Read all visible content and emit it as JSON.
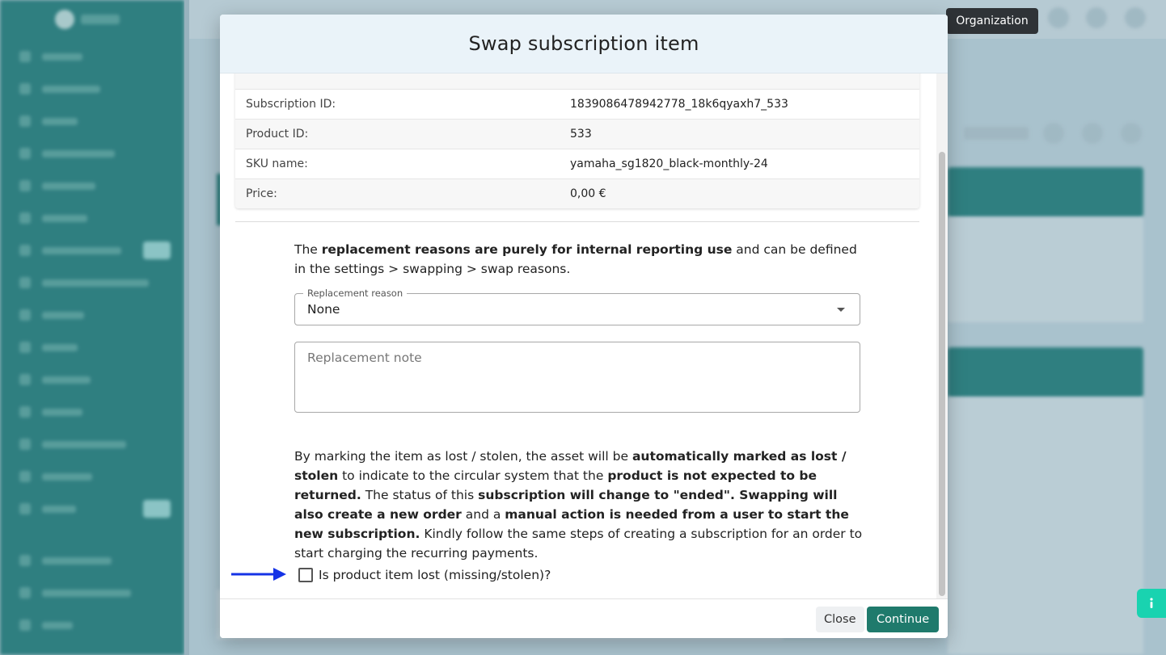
{
  "tooltip": {
    "label": "Organization"
  },
  "modal": {
    "title": "Swap subscription item",
    "details": [
      {
        "label": "Subscription ID:",
        "value": "1839086478942778_18k6qyaxh7_533"
      },
      {
        "label": "Product ID:",
        "value": "533"
      },
      {
        "label": "SKU name:",
        "value": "yamaha_sg1820_black-monthly-24"
      },
      {
        "label": "Price:",
        "value": "0,00 €"
      }
    ],
    "reasons_info": {
      "p1": "The ",
      "b1": "replacement reasons are purely for internal reporting use",
      "p2": " and can be defined in the settings > swapping > swap reasons."
    },
    "reason_select": {
      "legend": "Replacement reason",
      "value": "None"
    },
    "note_field": {
      "placeholder": "Replacement note"
    },
    "lost_info": {
      "p1": "By marking the item as lost / stolen, the asset will be ",
      "b1": "automatically marked as lost / stolen",
      "p2": " to indicate to the circular system that the ",
      "b2": "product is not expected to be returned.",
      "p3": " The status of this ",
      "b3": "subscription will change to \"ended\". Swapping will also create a new order",
      "p4": " and a ",
      "b4": "manual action is needed from a user to start the new subscription.",
      "p5": " Kindly follow the same steps of creating a subscription for an order to start charging the recurring payments."
    },
    "lost_checkbox": {
      "label": "Is product item lost (missing/stolen)?",
      "checked": false
    },
    "footer": {
      "close_label": "Close",
      "continue_label": "Continue"
    }
  },
  "colors": {
    "primary": "#1f7a6c",
    "sidebar": "#1f7a78",
    "arrow": "#1533e6",
    "info_fab": "#19d3b0"
  }
}
